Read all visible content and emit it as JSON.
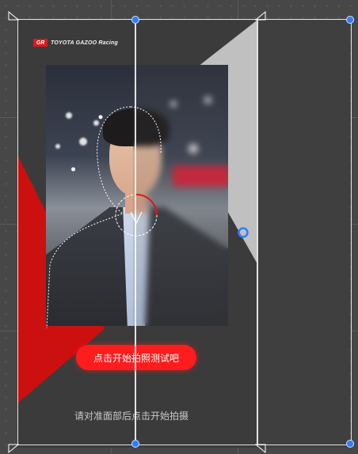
{
  "logo": {
    "mark": "GR",
    "text": "TOYOTA GAZOO Racing"
  },
  "main": {
    "start_button": "点击开始拍照测试吧",
    "hint": "请对准面部后点击开始拍摄"
  },
  "icons": {
    "portrait": "portrait-photo",
    "handles": "selection-handle-icon",
    "anchor": "anchor-icon"
  },
  "colors": {
    "accent": "#ff1c1c",
    "frame": "#3b3b3b",
    "handle": "#2f7cff"
  }
}
